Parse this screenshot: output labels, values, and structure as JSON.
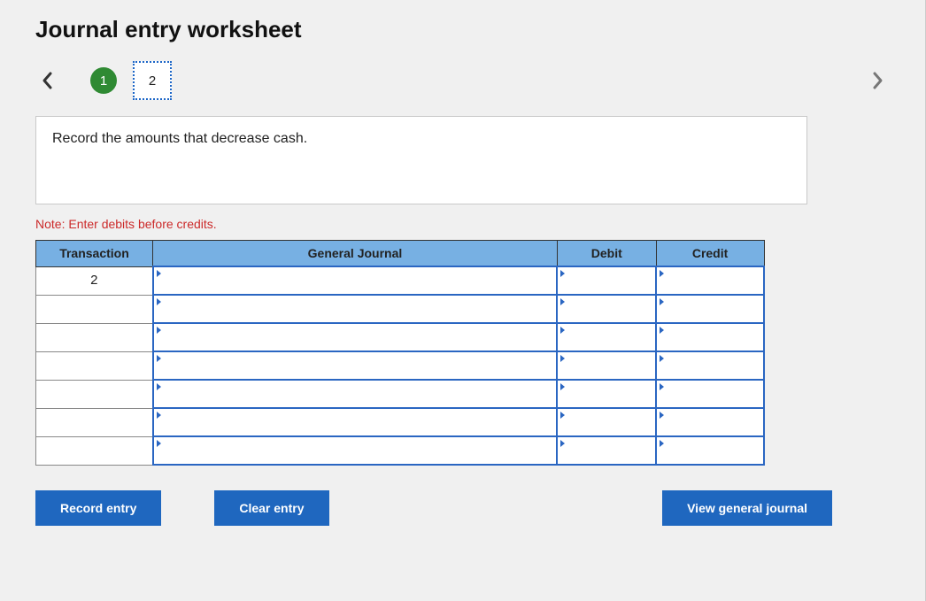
{
  "title": "Journal entry worksheet",
  "pager": {
    "steps": [
      "1",
      "2"
    ]
  },
  "instruction": "Record the amounts that decrease cash.",
  "note": "Note: Enter debits before credits.",
  "table": {
    "headers": {
      "transaction": "Transaction",
      "general_journal": "General Journal",
      "debit": "Debit",
      "credit": "Credit"
    },
    "rows": [
      {
        "transaction": "2",
        "journal": "",
        "debit": "",
        "credit": ""
      },
      {
        "transaction": "",
        "journal": "",
        "debit": "",
        "credit": ""
      },
      {
        "transaction": "",
        "journal": "",
        "debit": "",
        "credit": ""
      },
      {
        "transaction": "",
        "journal": "",
        "debit": "",
        "credit": ""
      },
      {
        "transaction": "",
        "journal": "",
        "debit": "",
        "credit": ""
      },
      {
        "transaction": "",
        "journal": "",
        "debit": "",
        "credit": ""
      },
      {
        "transaction": "",
        "journal": "",
        "debit": "",
        "credit": ""
      }
    ]
  },
  "buttons": {
    "record": "Record entry",
    "clear": "Clear entry",
    "view": "View general journal"
  }
}
